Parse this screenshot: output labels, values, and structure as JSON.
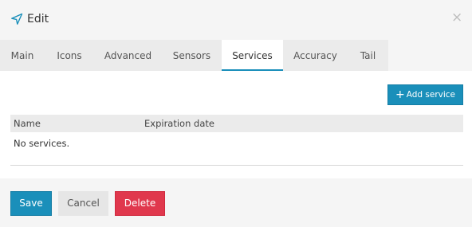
{
  "dialog": {
    "title": "Edit",
    "title_icon": "navigation-arrow-icon",
    "close_symbol": "×"
  },
  "tabs": [
    {
      "label": "Main",
      "active": false
    },
    {
      "label": "Icons",
      "active": false
    },
    {
      "label": "Advanced",
      "active": false
    },
    {
      "label": "Sensors",
      "active": false
    },
    {
      "label": "Services",
      "active": true
    },
    {
      "label": "Accuracy",
      "active": false
    },
    {
      "label": "Tail",
      "active": false
    }
  ],
  "services": {
    "add_button_label": "Add service",
    "columns": [
      "Name",
      "Expiration date"
    ],
    "empty_message": "No services."
  },
  "footer": {
    "save_label": "Save",
    "cancel_label": "Cancel",
    "delete_label": "Delete"
  },
  "colors": {
    "accent": "#1a8fba",
    "danger": "#e0384d",
    "tab_bar": "#ebebeb",
    "background": "#f5f5f5"
  }
}
